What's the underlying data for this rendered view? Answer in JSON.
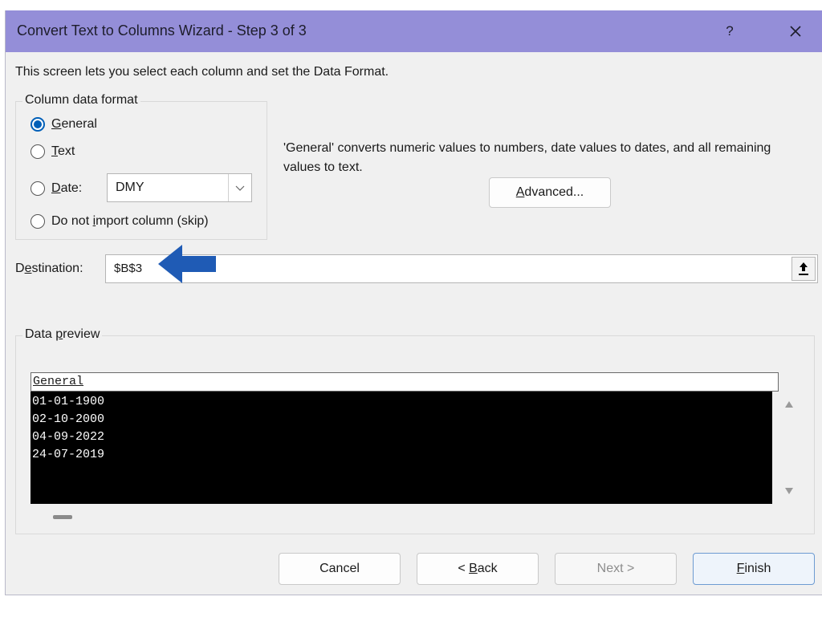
{
  "window": {
    "title": "Convert Text to Columns Wizard - Step 3 of 3",
    "help_label": "?"
  },
  "instructions": "This screen lets you select each column and set the Data Format.",
  "column_format": {
    "legend": "Column data format",
    "options": [
      {
        "pre": "",
        "key": "G",
        "post": "eneral",
        "checked": true
      },
      {
        "pre": "",
        "key": "T",
        "post": "ext",
        "checked": false
      },
      {
        "pre": "",
        "key": "D",
        "post": "ate:",
        "checked": false
      },
      {
        "pre": "Do not ",
        "key": "i",
        "post": "mport column (skip)",
        "checked": false
      }
    ],
    "date_format": "DMY"
  },
  "description": "'General' converts numeric values to numbers, date values to dates, and all remaining values to text.",
  "advanced_button": {
    "key": "A",
    "post": "dvanced..."
  },
  "destination": {
    "label_pre": "D",
    "label_key": "e",
    "label_post": "stination:",
    "value": "$B$3"
  },
  "preview": {
    "legend_pre": "Data ",
    "legend_key": "p",
    "legend_post": "review",
    "column_header": "General",
    "rows": [
      "01-01-1900",
      "02-10-2000",
      "04-09-2022",
      "24-07-2019"
    ]
  },
  "buttons": {
    "cancel": "Cancel",
    "back_pre": "< ",
    "back_key": "B",
    "back_post": "ack",
    "next": "Next >",
    "finish_key": "F",
    "finish_post": "inish"
  },
  "colors": {
    "titlebar": "#948ed8",
    "accent": "#005fb8",
    "annotation_arrow": "#1f5bb5"
  }
}
